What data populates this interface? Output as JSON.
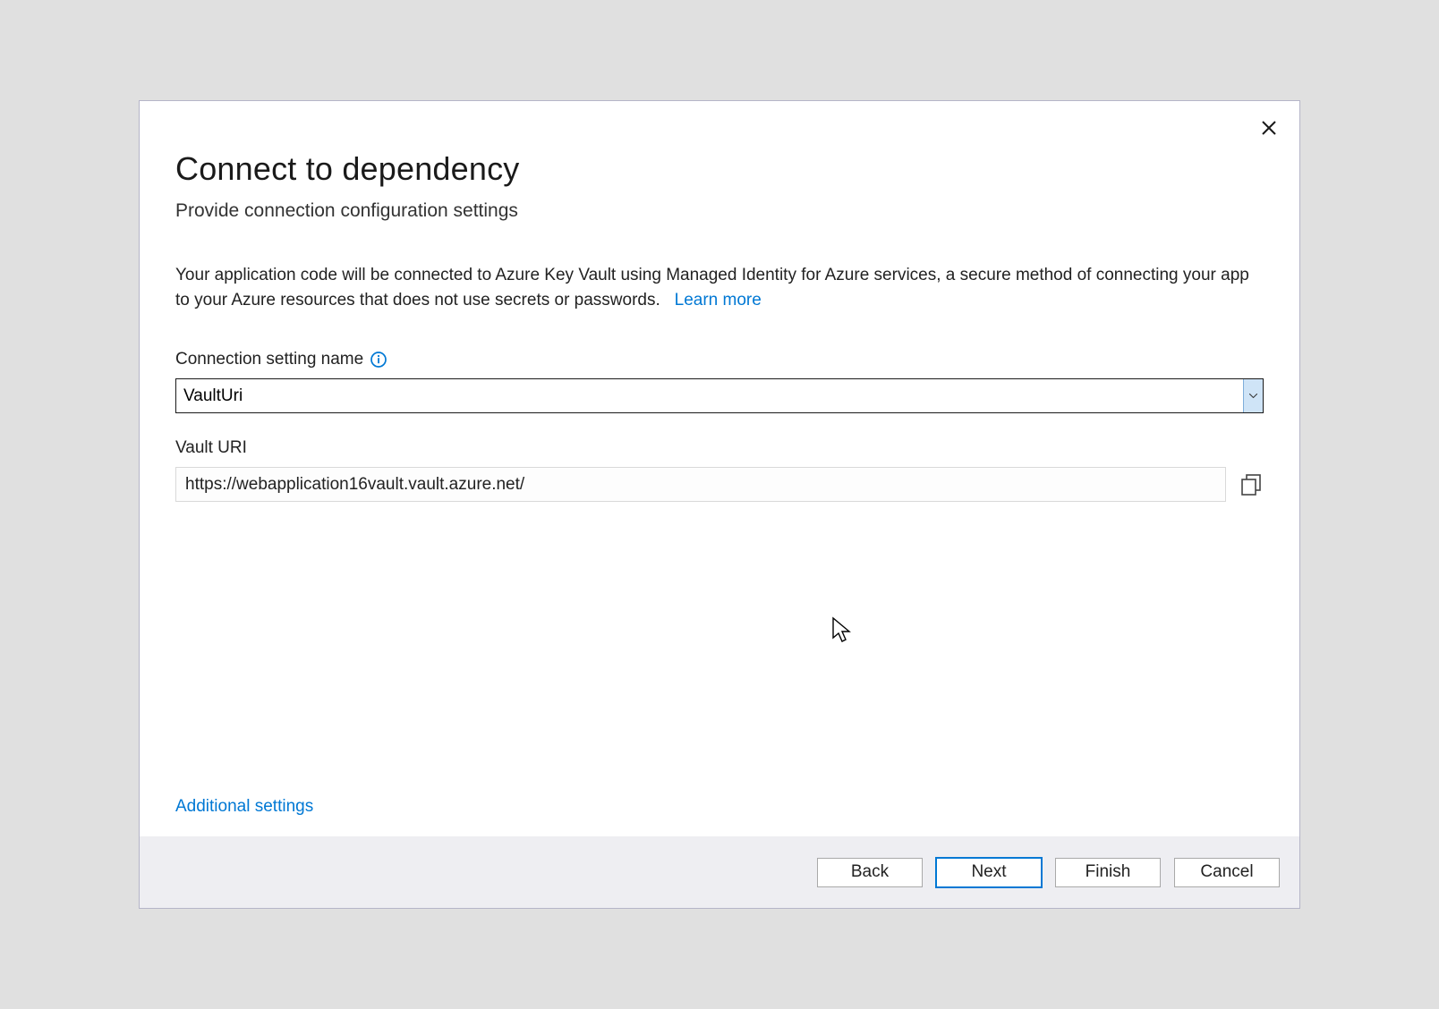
{
  "header": {
    "title": "Connect to dependency",
    "subtitle": "Provide connection configuration settings"
  },
  "description": {
    "text": "Your application code will be connected to Azure Key Vault using Managed Identity for Azure services, a secure method of connecting your app to your Azure resources that does not use secrets or passwords.",
    "learn_more": "Learn more"
  },
  "fields": {
    "connection_setting": {
      "label": "Connection setting name",
      "value": "VaultUri"
    },
    "vault_uri": {
      "label": "Vault URI",
      "value": "https://webapplication16vault.vault.azure.net/"
    }
  },
  "links": {
    "additional_settings": "Additional settings"
  },
  "buttons": {
    "back": "Back",
    "next": "Next",
    "finish": "Finish",
    "cancel": "Cancel"
  }
}
